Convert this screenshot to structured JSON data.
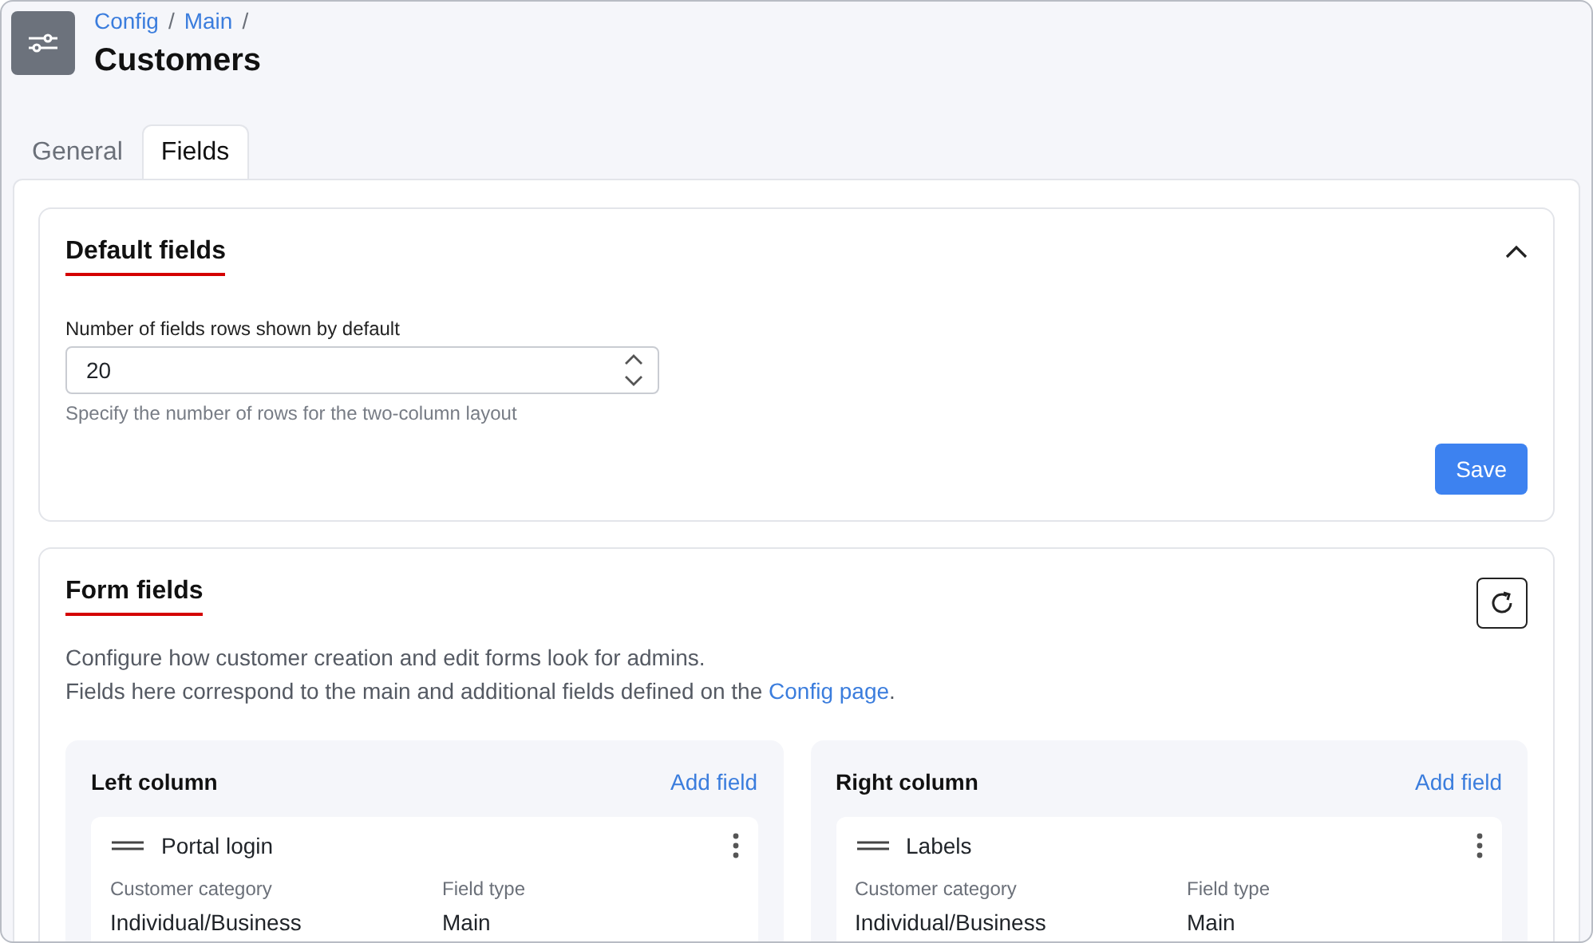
{
  "breadcrumb": [
    {
      "label": "Config",
      "separator": "/"
    },
    {
      "label": "Main",
      "separator": "/"
    }
  ],
  "title": "Customers",
  "tabs": [
    {
      "label": "General",
      "selected": false
    },
    {
      "label": "Fields",
      "selected": true
    }
  ],
  "default_fields": {
    "title": "Default fields",
    "expanded": true,
    "field_label": "Number of fields rows shown by default",
    "value": "20",
    "hint": "Specify the number of rows for the two-column layout",
    "save": "Save"
  },
  "form_fields": {
    "title": "Form fields",
    "description": "Configure how customer creation and edit forms look for admins.",
    "note_before": "Fields here correspond to the main and additional fields defined on the ",
    "note_link": "Config page",
    "note_after": ".",
    "columns": [
      {
        "title": "Left column",
        "add": "Add field",
        "fields": [
          {
            "name": "Portal login",
            "props": [
              {
                "label": "Customer category",
                "value": "Individual/Business"
              },
              {
                "label": "Field type",
                "value": "Main"
              }
            ]
          }
        ]
      },
      {
        "title": "Right column",
        "add": "Add field",
        "fields": [
          {
            "name": "Labels",
            "props": [
              {
                "label": "Customer category",
                "value": "Individual/Business"
              },
              {
                "label": "Field type",
                "value": "Main"
              }
            ]
          }
        ]
      }
    ]
  }
}
